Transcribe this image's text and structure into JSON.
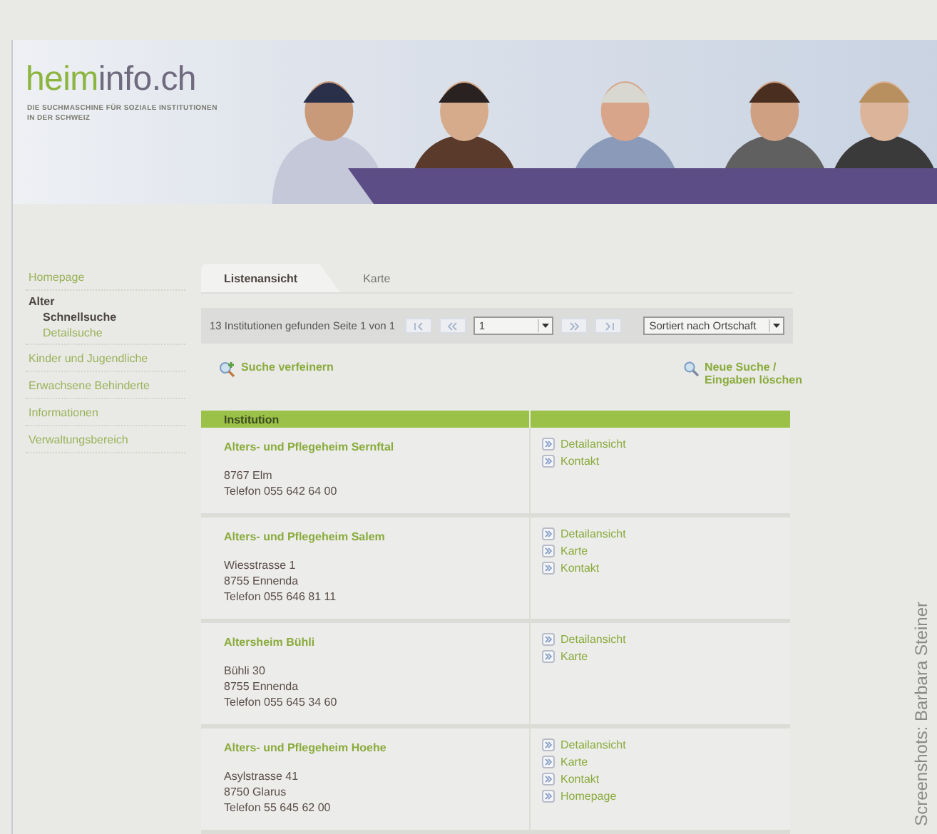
{
  "header": {
    "logo": {
      "first": "heim",
      "second": "info.ch"
    },
    "tagline": [
      "DIE SUCHMASCHINE FÜR SOZIALE INSTITUTIONEN",
      "IN DER SCHWEIZ"
    ]
  },
  "sidebar": {
    "items": [
      {
        "label": "Homepage",
        "expanded": false
      },
      {
        "label": "Alter",
        "expanded": true,
        "children": [
          {
            "label": "Schnellsuche",
            "selected": true
          },
          {
            "label": "Detailsuche",
            "selected": false
          }
        ]
      },
      {
        "label": "Kinder und Jugendliche",
        "expanded": false
      },
      {
        "label": "Erwachsene Behinderte",
        "expanded": false
      },
      {
        "label": "Informationen",
        "expanded": false
      },
      {
        "label": "Verwaltungsbereich",
        "expanded": false
      }
    ]
  },
  "tabs": [
    {
      "label": "Listenansicht",
      "selected": true
    },
    {
      "label": "Karte",
      "selected": false
    }
  ],
  "pager": {
    "summary": "13 Institutionen gefunden Seite 1 von 1",
    "page": "1",
    "sort": "Sortiert nach Ortschaft"
  },
  "actions": {
    "refine": "Suche verfeinern",
    "reset": "Neue Suche / Eingaben löschen"
  },
  "table": {
    "columns": [
      "Institution"
    ],
    "rows": [
      {
        "name": "Alters- und Pflegeheim Sernftal",
        "address": [
          "8767 Elm",
          "Telefon 055 642 64 00"
        ],
        "links": [
          "Detailansicht",
          "Kontakt"
        ]
      },
      {
        "name": "Alters- und Pflegeheim Salem",
        "address": [
          "Wiesstrasse 1",
          "8755 Ennenda",
          "Telefon 055 646 81 11"
        ],
        "links": [
          "Detailansicht",
          "Karte",
          "Kontakt"
        ]
      },
      {
        "name": "Altersheim Bühli",
        "address": [
          "Bühli 30",
          "8755 Ennenda",
          "Telefon 055 645 34 60"
        ],
        "links": [
          "Detailansicht",
          "Karte"
        ]
      },
      {
        "name": "Alters- und Pflegeheim Hoehe",
        "address": [
          "Asylstrasse 41",
          "8750 Glarus",
          "Telefon 55 645 62 00"
        ],
        "links": [
          "Detailansicht",
          "Karte",
          "Kontakt",
          "Homepage"
        ]
      }
    ]
  },
  "caption": "Screenshots: Barbara Steiner"
}
